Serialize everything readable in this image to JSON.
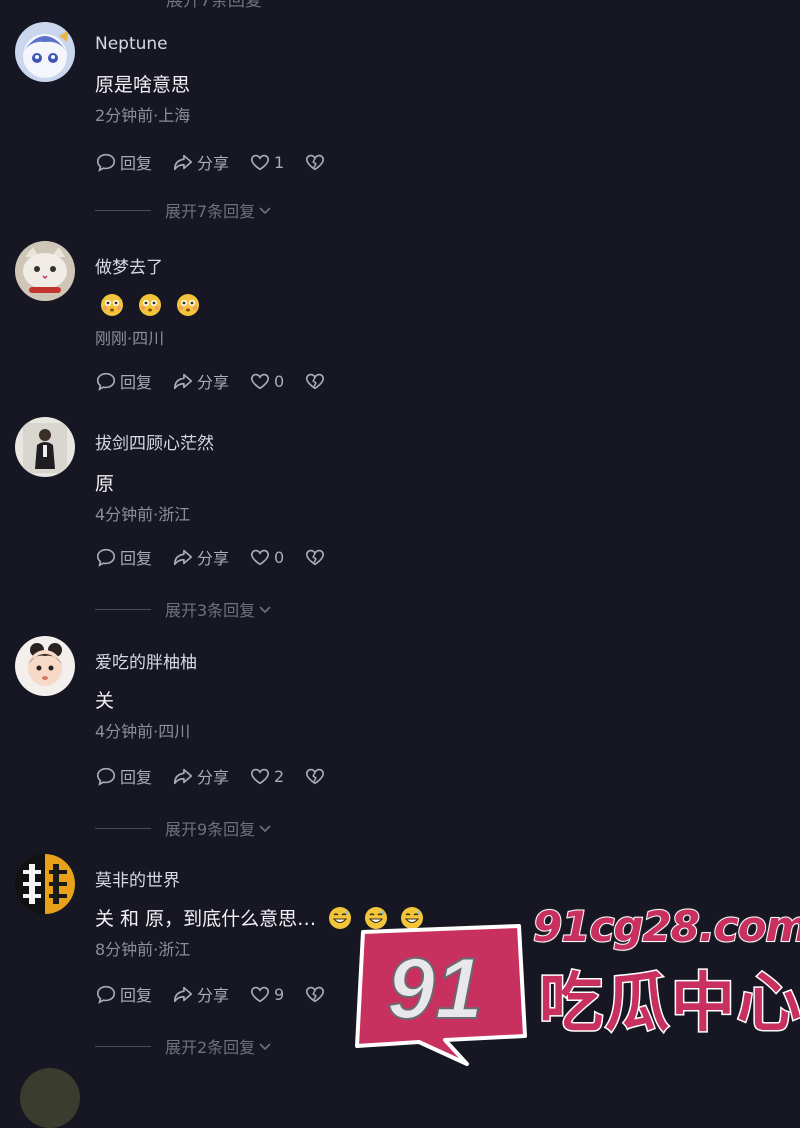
{
  "top_expand_cut": "展开7条回复",
  "actions_labels": {
    "reply": "回复",
    "share": "分享"
  },
  "colors": {
    "background": "#161722",
    "text": "#e9e9ee",
    "meta": "#8c8e99",
    "watermark": "#c8305f"
  },
  "comments": [
    {
      "username": "Neptune",
      "content": "原是啥意思",
      "emojis": [],
      "time_location": "2分钟前·上海",
      "likes": "1",
      "expand": "展开7条回复",
      "avatar_icon": "anime-avatar-icon"
    },
    {
      "username": "做梦去了",
      "content": "",
      "emojis": [
        "flushed-emoji-icon",
        "flushed-emoji-icon",
        "flushed-emoji-icon"
      ],
      "time_location": "刚刚·四川",
      "likes": "0",
      "expand": "",
      "avatar_icon": "cat-avatar-icon"
    },
    {
      "username": "拔剑四顾心茫然",
      "content": "原",
      "emojis": [],
      "time_location": "4分钟前·浙江",
      "likes": "0",
      "expand": "展开3条回复",
      "avatar_icon": "person-avatar-icon"
    },
    {
      "username": "爱吃的胖柚柚",
      "content": "关",
      "emojis": [],
      "time_location": "4分钟前·四川",
      "likes": "2",
      "expand": "展开9条回复",
      "avatar_icon": "baby-avatar-icon"
    },
    {
      "username": "莫非的世界",
      "content": "关 和 原，到底什么意思…",
      "emojis": [
        "grin-sweat-emoji-icon",
        "grin-sweat-emoji-icon",
        "grin-sweat-emoji-icon"
      ],
      "time_location": "8分钟前·浙江",
      "likes": "9",
      "expand": "展开2条回复",
      "avatar_icon": "logo-avatar-icon"
    }
  ],
  "watermark": {
    "badge": "91",
    "url": "91cg28.com",
    "name": "吃瓜中心"
  }
}
